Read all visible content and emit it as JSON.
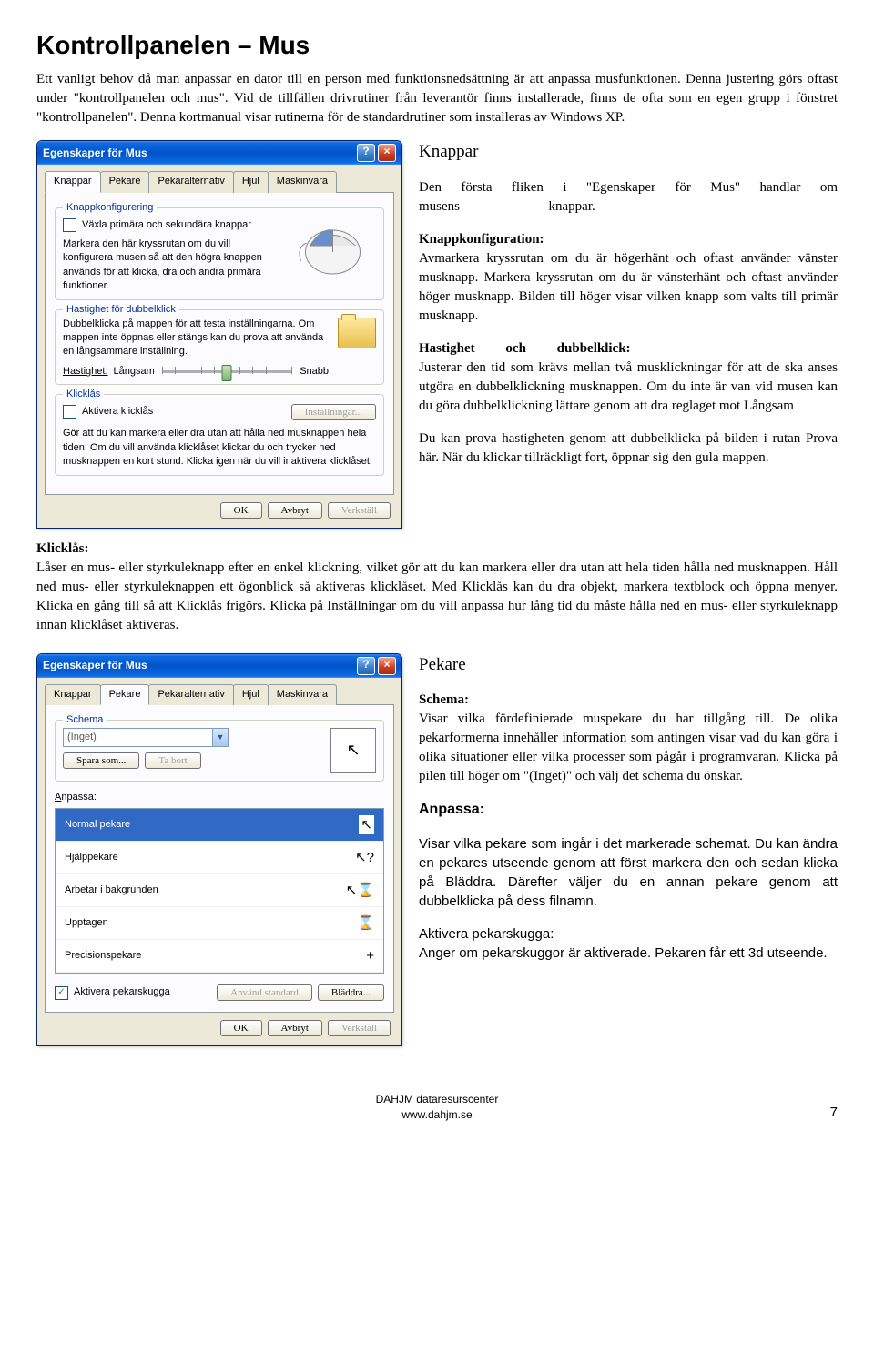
{
  "doc": {
    "title": "Kontrollpanelen – Mus",
    "intro": "Ett vanligt behov då man anpassar en dator till en person med funktionsnedsättning är att anpassa musfunktionen. Denna justering görs oftast under \"kontrollpanelen och mus\". Vid de tillfällen drivrutiner från leverantör finns installerade, finns de ofta som en egen grupp i fönstret \"kontrollpanelen\". Denna kortmanual visar rutinerna för de standardrutiner som installeras av Windows XP.",
    "knappar": {
      "heading": "Knappar",
      "para1a": "Den första fliken i \"Egenskaper för Mus\" handlar om musens",
      "para1b": "knappar.",
      "knappkonf_label": "Knappkonfiguration:",
      "knappkonf_text": "Avmarkera kryssrutan om du är högerhänt och oftast använder vänster musknapp. Markera kryssrutan om du är vänsterhänt och oftast använder höger musknapp. Bilden till höger visar vilken knapp som valts till primär musknapp.",
      "hast_label_a": "Hastighet",
      "hast_label_b": "och",
      "hast_label_c": "dubbelklick:",
      "hast_text": "Justerar den tid som krävs mellan två musklickningar för att de ska anses utgöra en dubbelklickning musknappen. Om du inte är van vid musen kan du göra dubbelklickning lättare genom att dra reglaget mot Långsam",
      "hast_text2": "Du kan prova hastigheten genom att dubbelklicka på bilden i rutan Prova här. När du klickar tillräckligt fort, öppnar sig den gula mappen."
    },
    "klicklas": {
      "label": "Klicklås:",
      "text": "Låser en mus- eller styrkuleknapp efter en enkel klickning, vilket gör att du kan markera eller dra utan att hela tiden hålla ned musknappen. Håll ned mus- eller styrkuleknappen ett ögonblick så aktiveras klicklåset. Med Klicklås kan du dra objekt, markera textblock och öppna menyer. Klicka en gång till så att Klicklås frigörs. Klicka på Inställningar om du vill anpassa hur lång tid du måste hålla ned en mus- eller styrkuleknapp innan klicklåset aktiveras."
    },
    "pekare": {
      "heading": "Pekare",
      "schema_label": "Schema:",
      "schema_text": "Visar vilka fördefinierade muspekare du har tillgång till. De olika pekarformerna innehåller information som antingen visar vad du kan göra i olika situationer eller vilka processer som pågår i programvaran. Klicka på pilen till höger om \"(Inget)\" och välj det schema du önskar.",
      "anpassa_label": "Anpassa:",
      "anpassa_text": "Visar vilka pekare som ingår i det markerade schemat. Du kan ändra en pekares utseende genom att först markera den och sedan klicka på Bläddra. Därefter väljer du en annan pekare genom att dubbelklicka på dess filnamn.",
      "aktivera_label": "Aktivera pekarskugga:",
      "aktivera_text": "Anger om pekarskuggor är aktiverade. Pekaren får ett 3d utseende."
    },
    "dialog1": {
      "title": "Egenskaper för Mus",
      "tabs": [
        "Knappar",
        "Pekare",
        "Pekaralternativ",
        "Hjul",
        "Maskinvara"
      ],
      "group1_title": "Knappkonfigurering",
      "group1_check": "Växla primära och sekundära knappar",
      "group1_desc": "Markera den här kryssrutan om du vill konfigurera musen så att den högra knappen används för att klicka, dra och andra primära funktioner.",
      "group2_title": "Hastighet för dubbelklick",
      "group2_desc": "Dubbelklicka på mappen för att testa inställningarna. Om mappen inte öppnas eller stängs kan du prova att använda en långsammare inställning.",
      "group2_speed": "Hastighet:",
      "group2_slow": "Långsam",
      "group2_fast": "Snabb",
      "group3_title": "Klicklås",
      "group3_check": "Aktivera klicklås",
      "group3_btn": "Inställningar...",
      "group3_desc": "Gör att du kan markera eller dra utan att hålla ned musknappen hela tiden. Om du vill använda klicklåset klickar du och trycker ned musknappen en kort stund. Klicka igen när du vill inaktivera klicklåset.",
      "ok": "OK",
      "cancel": "Avbryt",
      "apply": "Verkställ"
    },
    "dialog2": {
      "title": "Egenskaper för Mus",
      "tabs": [
        "Knappar",
        "Pekare",
        "Pekaralternativ",
        "Hjul",
        "Maskinvara"
      ],
      "schema_group": "Schema",
      "schema_value": "(Inget)",
      "save_as": "Spara som...",
      "delete": "Ta bort",
      "anpassa_label": "Anpassa:",
      "cursors": [
        {
          "name": "Normal pekare",
          "glyph": "↖"
        },
        {
          "name": "Hjälppekare",
          "glyph": "↖?"
        },
        {
          "name": "Arbetar i bakgrunden",
          "glyph": "↖⌛"
        },
        {
          "name": "Upptagen",
          "glyph": "⌛"
        },
        {
          "name": "Precisionspekare",
          "glyph": "+"
        }
      ],
      "shadow_check": "Aktivera pekarskugga",
      "use_default": "Använd standard",
      "browse": "Bläddra...",
      "ok": "OK",
      "cancel": "Avbryt",
      "apply": "Verkställ"
    },
    "footer": {
      "org": "DAHJM dataresurscenter",
      "url": "www.dahjm.se",
      "page": "7"
    }
  }
}
